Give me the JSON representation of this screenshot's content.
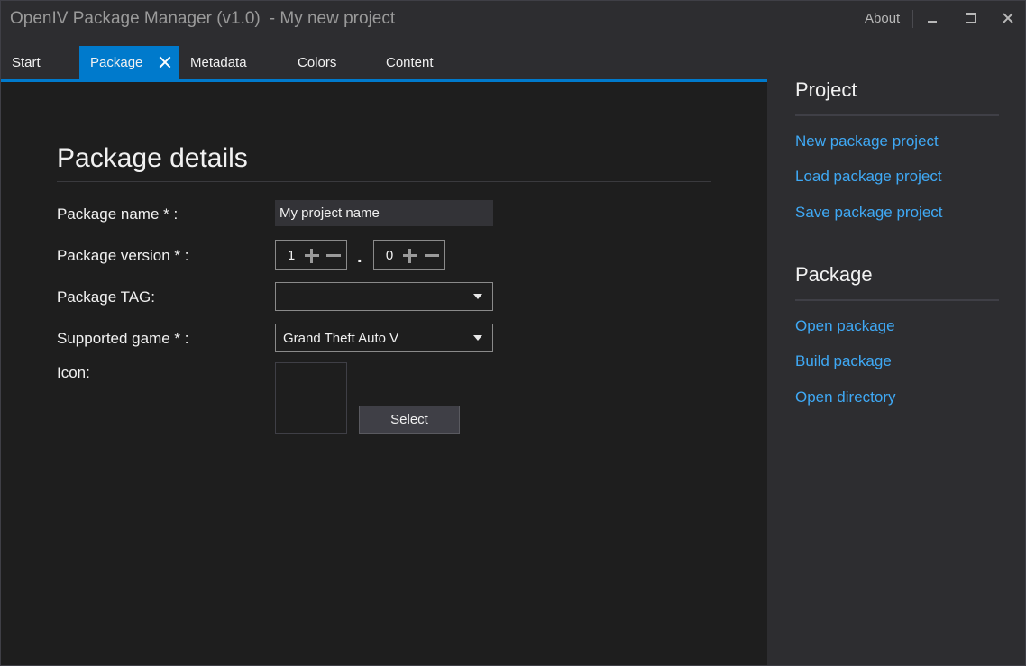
{
  "window": {
    "app_title": "OpenIV Package Manager (v1.0)",
    "project_title": "- My new project",
    "about_label": "About"
  },
  "tabs": [
    {
      "label": "Start"
    },
    {
      "label": "Package",
      "active": true
    },
    {
      "label": "Metadata"
    },
    {
      "label": "Colors"
    },
    {
      "label": "Content"
    }
  ],
  "form": {
    "section_title": "Package details",
    "name_label": "Package name * :",
    "name_value": "My project name",
    "version_label": "Package version * :",
    "version_major": "1",
    "version_separator": ".",
    "version_minor": "0",
    "tag_label": "Package TAG:",
    "tag_value": "",
    "game_label": "Supported game * :",
    "game_value": "Grand Theft Auto V",
    "icon_label": "Icon:",
    "select_button": "Select"
  },
  "sidebar": {
    "project_heading": "Project",
    "project_links": [
      "New package project",
      "Load package project",
      "Save package project"
    ],
    "package_heading": "Package",
    "package_links": [
      "Open package",
      "Build package",
      "Open directory"
    ]
  },
  "colors": {
    "accent": "#007acc",
    "link": "#3fa9f5",
    "main_bg": "#1e1e1e",
    "side_bg": "#2d2d30"
  }
}
